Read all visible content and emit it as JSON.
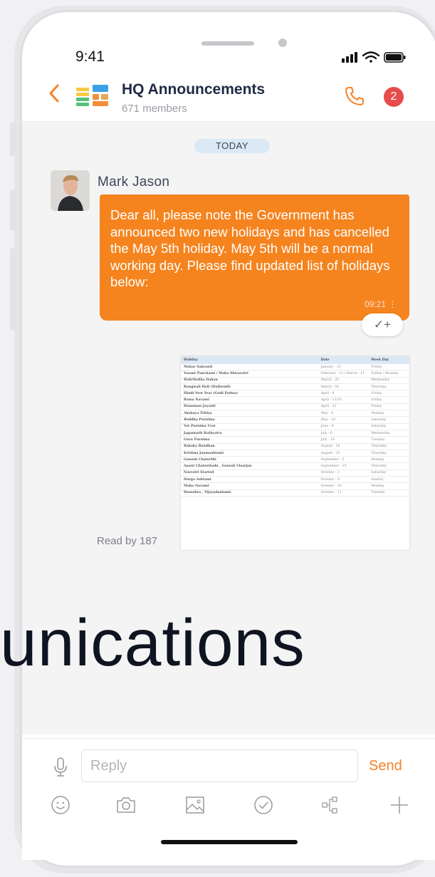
{
  "status_bar": {
    "time": "9:41"
  },
  "header": {
    "channel_name": "HQ Announcements",
    "member_count": "671 members",
    "notification_count": "2",
    "accent_color": "#f5822a"
  },
  "chat": {
    "date_divider": "TODAY",
    "message": {
      "sender": "Mark Jason",
      "text": "Dear all, please note the Government has announced two new holidays and has cancelled the May 5th holiday. May 5th will be a normal working day. Please find updated list of holidays below:",
      "time": "09:21",
      "reaction": "✓+",
      "bubble_color": "#f5841f"
    },
    "read_receipt": "Read by 187",
    "attachment_table": {
      "headers": [
        "Holiday",
        "Date",
        "Week Day"
      ],
      "rows": [
        [
          "Makar Sakranti",
          "January - 15",
          "Friday"
        ],
        [
          "Vasant Panchami / Maha Shivaratri",
          "February - 12 / March - 11",
          "Friday / Monday"
        ],
        [
          "Holi/Holika Dahan",
          "March - 29",
          "Wednesday"
        ],
        [
          "Rangwali Holi (Dulhendi)",
          "March - 04",
          "Thursday"
        ],
        [
          "Hindi New Year (Gudi Padwa)",
          "April - 8",
          "Friday"
        ],
        [
          "Rama Navami",
          "April - 13/16",
          "Friday"
        ],
        [
          "Hanuman Jayanti",
          "April - 22",
          "Friday"
        ],
        [
          "Akshaya Tritiya",
          "May - 4",
          "Monday"
        ],
        [
          "Buddha Purnima",
          "May - 10",
          "Saturday"
        ],
        [
          "Vat Purnima Vrat",
          "June - 4",
          "Saturday"
        ],
        [
          "Jagannath Rathyatra",
          "July - 6",
          "Wednesday"
        ],
        [
          "Guru Purnima",
          "July - 19",
          "Tuesday"
        ],
        [
          "Raksha Bandhan",
          "August - 18",
          "Thursday"
        ],
        [
          "Krishna Janmashtami",
          "August - 25",
          "Thursday"
        ],
        [
          "Ganesh Chaturthi",
          "September - 5",
          "Monday"
        ],
        [
          "Anant Chaturdashi , Ganesh Visarjan",
          "September - 15",
          "Thursday"
        ],
        [
          "Navratri Started",
          "October - 1",
          "Saturday"
        ],
        [
          "Durga Ashtami",
          "October - 9",
          "Sunday"
        ],
        [
          "Maha Navami",
          "October - 10",
          "Monday"
        ],
        [
          "Dussehra , Vijayadashami",
          "October - 11",
          "Tuesday"
        ]
      ]
    }
  },
  "overlay_text": "unications",
  "composer": {
    "placeholder": "Reply",
    "send_label": "Send",
    "tools": [
      "emoji-icon",
      "camera-icon",
      "image-icon",
      "check-circle-icon",
      "share-icon",
      "plus-icon"
    ]
  }
}
